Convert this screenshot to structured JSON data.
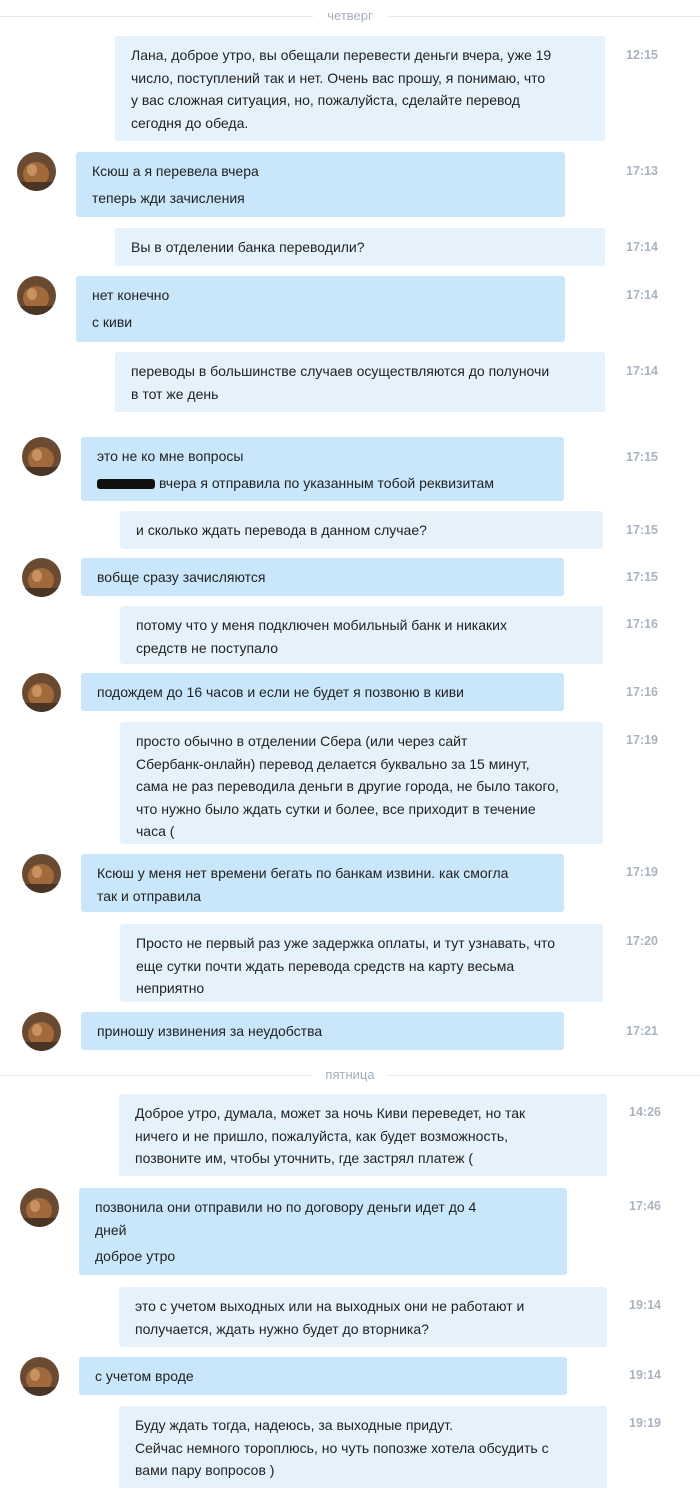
{
  "days": [
    "четверг",
    "пятница"
  ],
  "messages": [
    {
      "time": "12:15",
      "lines": [
        "Лана, доброе утро, вы обещали перевести деньги вчера, уже 19",
        "число, поступлений так и нет. Очень вас прошу, я понимаю, что",
        "у вас сложная ситуация, но, пожалуйста, сделайте перевод",
        "сегодня до обеда."
      ]
    },
    {
      "time": "17:13",
      "lines": [
        "Ксюш а я перевела вчера",
        "теперь жди зачисления"
      ]
    },
    {
      "time": "17:14",
      "lines": [
        "Вы в отделении банка переводили?"
      ]
    },
    {
      "time": "17:14",
      "lines": [
        "нет конечно",
        "с киви"
      ]
    },
    {
      "time": "17:14",
      "lines": [
        "переводы в большинстве случаев осуществляются до полуночи",
        "в тот же день"
      ]
    },
    {
      "time": "17:15",
      "lines": [
        "это не ко мне вопросы",
        "вчера я отправила по указанным тобой реквизитам"
      ]
    },
    {
      "time": "17:15",
      "lines": [
        "и сколько ждать перевода в данном случае?"
      ]
    },
    {
      "time": "17:15",
      "lines": [
        "вобще сразу зачисляются"
      ]
    },
    {
      "time": "17:16",
      "lines": [
        "потому что у меня подключен мобильный банк и никаких",
        "средств не поступало"
      ]
    },
    {
      "time": "17:16",
      "lines": [
        "подождем до 16 часов и если не будет я позвоню в киви"
      ]
    },
    {
      "time": "17:19",
      "lines": [
        "просто обычно в отделении Сбера (или через сайт",
        "Сбербанк-онлайн) перевод делается буквально за 15 минут,",
        "сама не раз переводила деньги в другие города, не было такого,",
        "что нужно было ждать сутки и более, все приходит в течение",
        "часа ("
      ]
    },
    {
      "time": "17:19",
      "lines": [
        "Ксюш у меня нет времени бегать по банкам извини. как смогла",
        "так и отправила"
      ]
    },
    {
      "time": "17:20",
      "lines": [
        "Просто не первый раз уже задержка оплаты, и тут узнавать, что",
        "еще сутки почти ждать перевода средств на карту весьма",
        "неприятно"
      ]
    },
    {
      "time": "17:21",
      "lines": [
        "приношу извинения за неудобства"
      ]
    },
    {
      "time": "14:26",
      "lines": [
        "Доброе утро, думала, может за ночь Киви переведет, но так",
        "ничего и не пришло, пожалуйста, как будет возможность,",
        "позвоните им, чтобы уточнить, где застрял платеж ("
      ]
    },
    {
      "time": "17:46",
      "lines": [
        "позвонила они отправили но по договору деньги идет до 4",
        "дней",
        "доброе утро"
      ]
    },
    {
      "time": "19:14",
      "lines": [
        "это с учетом выходных или на выходных они не работают и",
        "получается, ждать нужно будет до вторника?"
      ]
    },
    {
      "time": "19:14",
      "lines": [
        "с учетом вроде"
      ]
    },
    {
      "time": "19:19",
      "lines": [
        "Буду ждать тогда, надеюсь, за выходные придут.",
        "Сейчас немного тороплюсь, но чуть попозже хотела обсудить с",
        "вами пару вопросов )"
      ]
    }
  ],
  "colors": {
    "outgoing": "#e6f2fb",
    "incoming": "#c9e6fb",
    "time": "#aab4bf",
    "divider": "#a6b0bc"
  }
}
